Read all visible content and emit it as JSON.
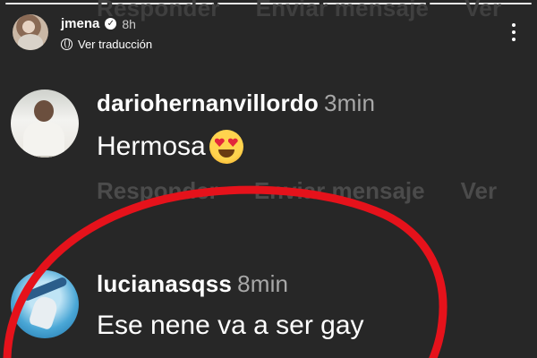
{
  "story": {
    "username": "jmena",
    "time": "8h",
    "translate_label": "Ver traducción"
  },
  "ghost_actions": {
    "reply": "Responder",
    "send": "Enviar mensaje",
    "more": "Ver"
  },
  "comments": [
    {
      "username": "dariohernanvillordo",
      "time": "3min",
      "text": "Hermosa",
      "emoji": "heart-eyes-emoji"
    },
    {
      "username": "lucianasqss",
      "time": "8min",
      "text": "Ese nene va a ser gay"
    }
  ],
  "comment_actions": {
    "reply": "Responder",
    "send": "Enviar mensaje",
    "more": "Ver"
  },
  "colors": {
    "background": "#272727",
    "annotation": "#e5121b",
    "muted_text": "#a8a8a8"
  }
}
